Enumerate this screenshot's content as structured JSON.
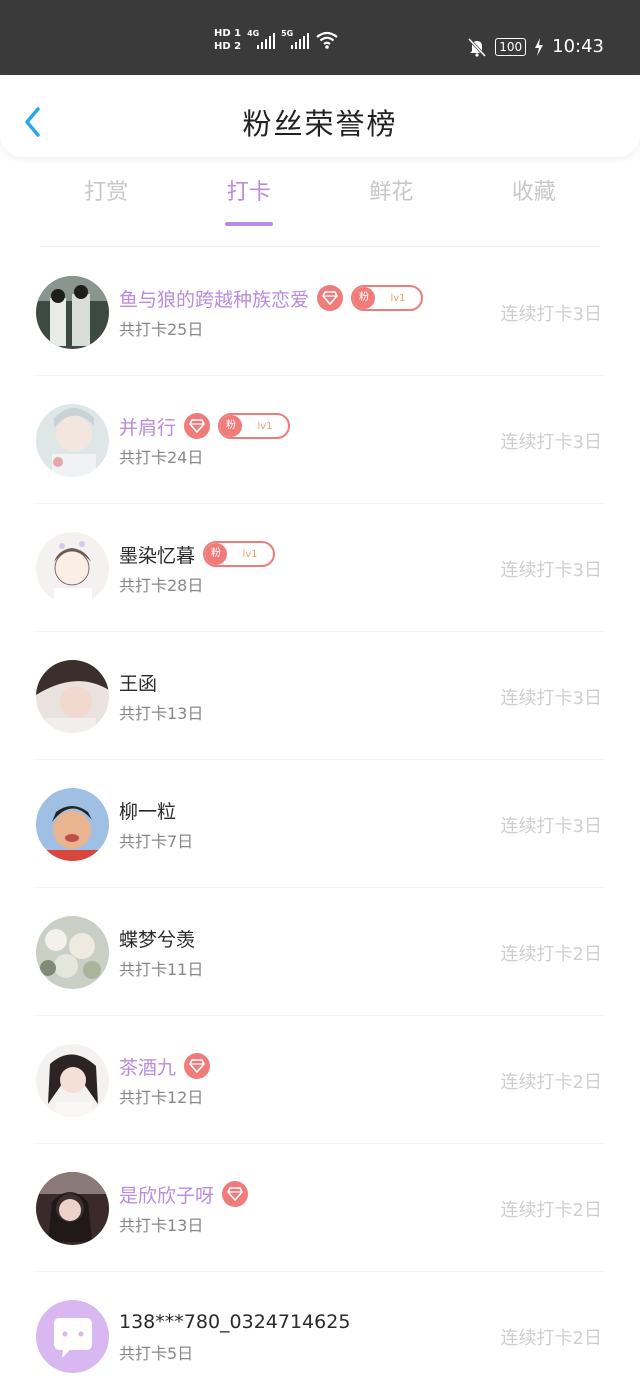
{
  "status_bar": {
    "hd1": "HD 1",
    "hd2": "HD 2",
    "sim1_gen": "4G",
    "sim2_gen": "5G",
    "battery": "100",
    "time": "10:43"
  },
  "header": {
    "title": "粉丝荣誉榜"
  },
  "tabs": [
    {
      "label": "打赏",
      "active": false
    },
    {
      "label": "打卡",
      "active": true
    },
    {
      "label": "鲜花",
      "active": false
    },
    {
      "label": "收藏",
      "active": false
    }
  ],
  "badge": {
    "fan_label": "粉",
    "level": "lv1"
  },
  "colors": {
    "accent": "#b98ce0",
    "badge": "#f07b7b",
    "muted": "#cfcfcf"
  },
  "fans": [
    {
      "name": "鱼与狼的跨越种族恋爱",
      "total": "共打卡25日",
      "streak": "连续打卡3日",
      "purple": true,
      "gem": true,
      "fanbadge": true,
      "avatar": "photo-couple"
    },
    {
      "name": "并肩行",
      "total": "共打卡24日",
      "streak": "连续打卡3日",
      "purple": true,
      "gem": true,
      "fanbadge": true,
      "avatar": "photo-boy-light"
    },
    {
      "name": "墨染忆暮",
      "total": "共打卡28日",
      "streak": "连续打卡3日",
      "purple": false,
      "gem": false,
      "fanbadge": true,
      "avatar": "drawing-boy"
    },
    {
      "name": "王函",
      "total": "共打卡13日",
      "streak": "连续打卡3日",
      "purple": false,
      "gem": false,
      "fanbadge": false,
      "avatar": "photo-boy-dark"
    },
    {
      "name": "柳一粒",
      "total": "共打卡7日",
      "streak": "连续打卡3日",
      "purple": false,
      "gem": false,
      "fanbadge": false,
      "avatar": "photo-kid"
    },
    {
      "name": "蝶梦兮羡",
      "total": "共打卡11日",
      "streak": "连续打卡2日",
      "purple": false,
      "gem": false,
      "fanbadge": false,
      "avatar": "photo-flowers"
    },
    {
      "name": "茶酒九",
      "total": "共打卡12日",
      "streak": "连续打卡2日",
      "purple": true,
      "gem": true,
      "fanbadge": false,
      "avatar": "photo-girl"
    },
    {
      "name": "是欣欣子呀",
      "total": "共打卡13日",
      "streak": "连续打卡2日",
      "purple": true,
      "gem": true,
      "fanbadge": false,
      "avatar": "photo-girl-dark"
    },
    {
      "name": "138***780_0324714625",
      "total": "共打卡5日",
      "streak": "连续打卡2日",
      "purple": false,
      "gem": false,
      "fanbadge": false,
      "avatar": "default-chat-icon"
    }
  ]
}
